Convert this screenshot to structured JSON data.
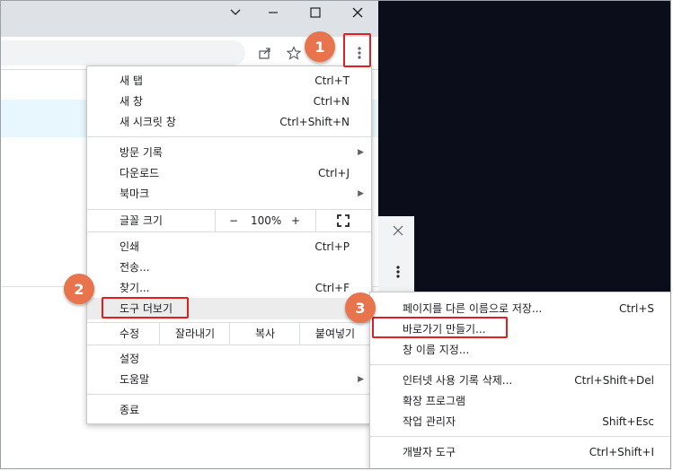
{
  "window": {
    "minimize_icon": "chevron-down",
    "restore_icon": "minimize",
    "maximize_icon": "maximize",
    "close_icon": "close"
  },
  "toolbar": {
    "share_icon": "share-icon",
    "bookmark_icon": "star-icon",
    "menu_icon": "kebab-menu-icon"
  },
  "badges": {
    "b1": "1",
    "b2": "2",
    "b3": "3"
  },
  "menu": {
    "new_tab": "새 탭",
    "new_tab_sc": "Ctrl+T",
    "new_window": "새 창",
    "new_window_sc": "Ctrl+N",
    "incognito": "새 시크릿 창",
    "incognito_sc": "Ctrl+Shift+N",
    "history": "방문 기록",
    "downloads": "다운로드",
    "downloads_sc": "Ctrl+J",
    "bookmarks": "북마크",
    "zoom_label": "글꼴 크기",
    "zoom_minus": "−",
    "zoom_value": "100%",
    "zoom_plus": "+",
    "print": "인쇄",
    "print_sc": "Ctrl+P",
    "cast": "전송...",
    "find": "찾기...",
    "find_sc": "Ctrl+F",
    "more_tools": "도구 더보기",
    "edit": "수정",
    "cut": "잘라내기",
    "copy": "복사",
    "paste": "붙여넣기",
    "settings": "설정",
    "help": "도움말",
    "exit": "종료"
  },
  "submenu": {
    "save_page": "페이지를 다른 이름으로 저장...",
    "save_page_sc": "Ctrl+S",
    "create_shortcut": "바로가기 만들기...",
    "name_window": "창 이름 지정...",
    "clear_data": "인터넷 사용 기록 삭제...",
    "clear_data_sc": "Ctrl+Shift+Del",
    "extensions": "확장 프로그램",
    "task_manager": "작업 관리자",
    "task_manager_sc": "Shift+Esc",
    "dev_tools": "개발자 도구",
    "dev_tools_sc": "Ctrl+Shift+I"
  },
  "colors": {
    "badge": "#e8744d",
    "highlight_box": "#e02020",
    "dark_bg": "#0b0e1a"
  }
}
